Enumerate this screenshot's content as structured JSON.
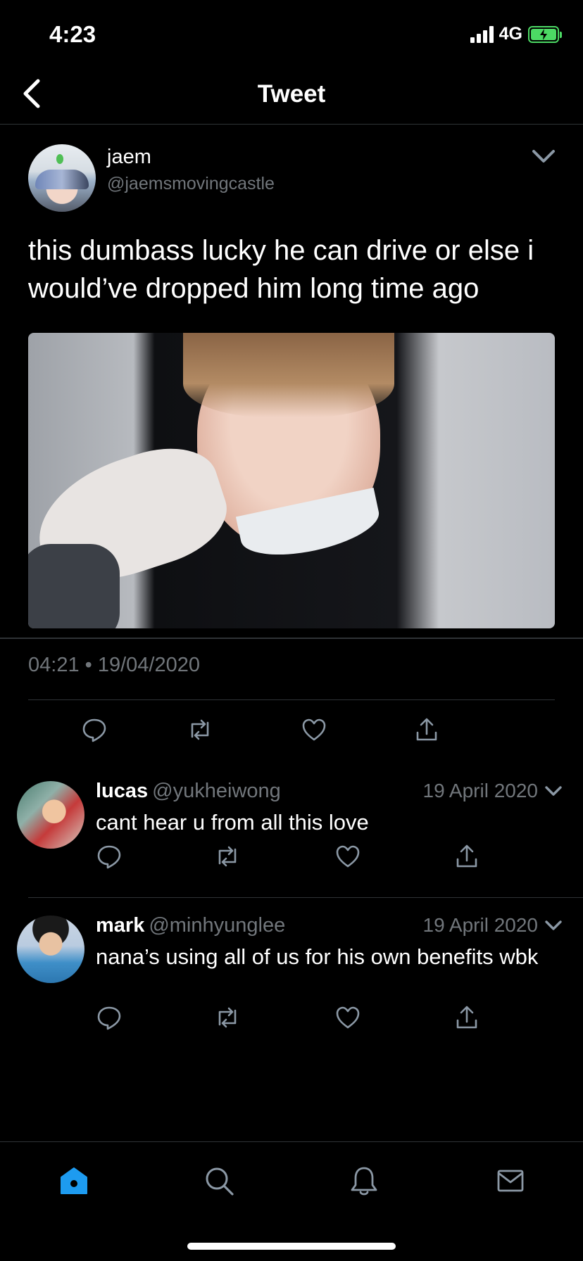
{
  "status_bar": {
    "time": "4:23",
    "network": "4G"
  },
  "nav": {
    "title": "Tweet"
  },
  "tweet": {
    "author_name": "jaem",
    "author_handle": "@jaemsmovingcastle",
    "text": "this dumbass lucky he can drive or else i would’ve dropped him long time ago",
    "timestamp": "04:21 • 19/04/2020"
  },
  "replies": [
    {
      "name": "lucas",
      "handle": "@yukheiwong",
      "date": "19 April 2020",
      "text": "cant hear u from all this love"
    },
    {
      "name": "mark",
      "handle": "@minhyunglee",
      "date": "19 April 2020",
      "text": "nana’s using all of us for his own benefits wbk"
    }
  ],
  "icons": [
    "back-icon",
    "chevron-down-icon",
    "reply-icon",
    "retweet-icon",
    "like-icon",
    "share-icon",
    "home-icon",
    "search-icon",
    "notifications-icon",
    "messages-icon"
  ],
  "colors": {
    "background": "#000000",
    "text": "#ffffff",
    "muted": "#71767b",
    "divider": "#2f3336",
    "accent": "#1d9bf0",
    "battery": "#4cd964"
  }
}
